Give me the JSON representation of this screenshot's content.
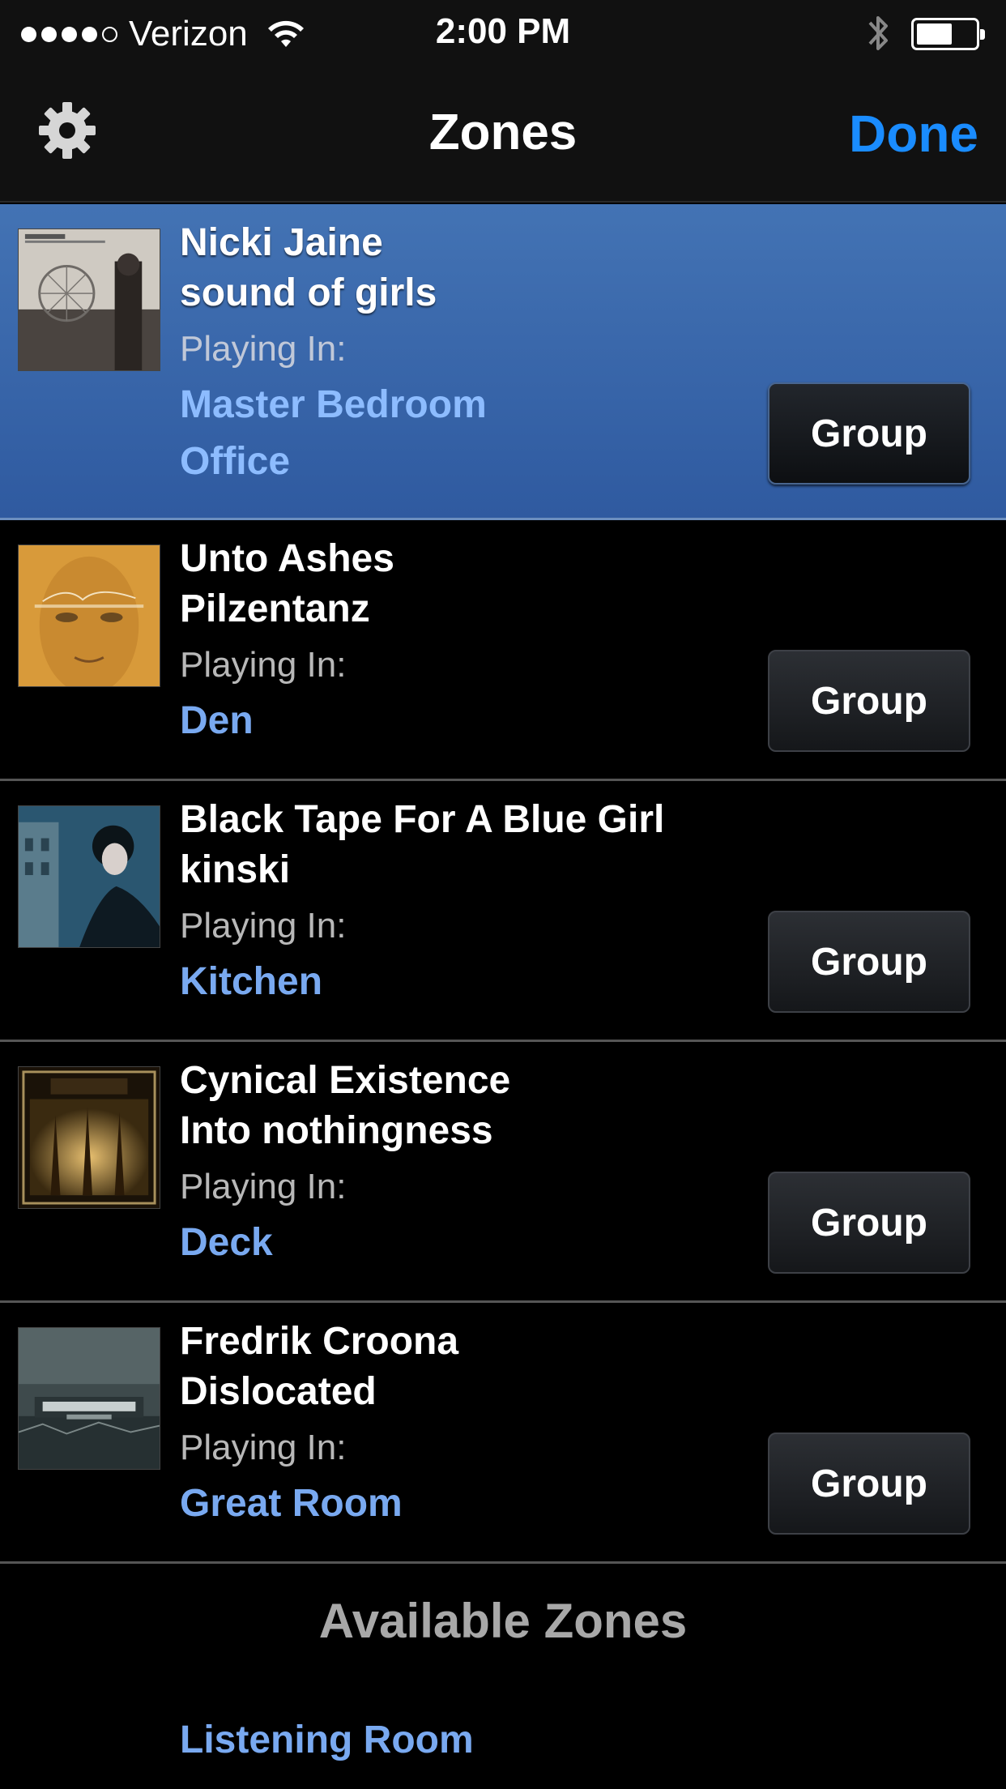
{
  "status_bar": {
    "carrier": "Verizon",
    "time": "2:00 PM",
    "signal_bars_filled": 4,
    "signal_bars_total": 5,
    "battery_level": 0.6
  },
  "nav": {
    "title": "Zones",
    "done_label": "Done",
    "settings_icon": "gear-icon"
  },
  "colors": {
    "accent": "#1a8cff",
    "room_link": "#79a9f0",
    "selected_row": "#3a66aa"
  },
  "zones": [
    {
      "artist": "Nicki Jaine",
      "track": "sound of girls",
      "playing_label": "Playing In:",
      "rooms": [
        "Master Bedroom",
        "Office"
      ],
      "group_label": "Group",
      "selected": true
    },
    {
      "artist": "Unto Ashes",
      "track": "Pilzentanz",
      "playing_label": "Playing In:",
      "rooms": [
        "Den"
      ],
      "group_label": "Group",
      "selected": false
    },
    {
      "artist": "Black Tape For A Blue Girl",
      "track": "kinski",
      "playing_label": "Playing In:",
      "rooms": [
        "Kitchen"
      ],
      "group_label": "Group",
      "selected": false
    },
    {
      "artist": "Cynical Existence",
      "track": "Into nothingness",
      "playing_label": "Playing In:",
      "rooms": [
        "Deck"
      ],
      "group_label": "Group",
      "selected": false
    },
    {
      "artist": "Fredrik Croona",
      "track": "Dislocated",
      "playing_label": "Playing In:",
      "rooms": [
        "Great Room"
      ],
      "group_label": "Group",
      "selected": false
    }
  ],
  "available": {
    "header": "Available Zones",
    "rooms": [
      "Listening Room"
    ]
  }
}
